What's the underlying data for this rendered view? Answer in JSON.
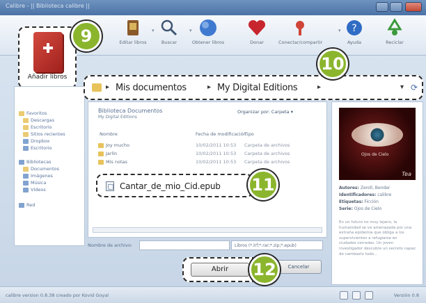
{
  "window": {
    "title": "Calibre - || Biblioteca calibre ||"
  },
  "toolbar": {
    "items": [
      {
        "label": "Añadir libros",
        "icon": "add-book-icon"
      },
      {
        "label": "Editar libros",
        "icon": "edit-metadata-icon"
      },
      {
        "label": "Buscar",
        "icon": "search-icon"
      },
      {
        "label": "Obtener libros",
        "icon": "globe-icon"
      },
      {
        "label": "Donar",
        "icon": "heart-icon"
      },
      {
        "label": "Conectar/compartir",
        "icon": "connect-share-icon"
      },
      {
        "label": "Ayuda",
        "icon": "help-icon"
      },
      {
        "label": "Reciclar",
        "icon": "recycle-icon"
      }
    ]
  },
  "add_book": {
    "label": "Añadir libros"
  },
  "steps": {
    "s9": "9",
    "s10": "10",
    "s11": "11",
    "s12": "12"
  },
  "address": {
    "crumbs": [
      "Mis documentos",
      "My Digital Editions"
    ],
    "separator": "▸"
  },
  "left_nav": {
    "items": [
      {
        "label": "Favoritos",
        "icon": "star"
      },
      {
        "label": "Descargas",
        "icon": "folder"
      },
      {
        "label": "Escritorio",
        "icon": "folder"
      },
      {
        "label": "Sitios recientes",
        "icon": "folder"
      },
      {
        "label": "Dropbox",
        "icon": "folder"
      },
      {
        "label": "Escritorio",
        "icon": "folder"
      },
      {
        "label": "Bibliotecas",
        "icon": "library"
      },
      {
        "label": "Documentos",
        "icon": "folder"
      },
      {
        "label": "Imágenes",
        "icon": "folder"
      },
      {
        "label": "Música",
        "icon": "folder"
      },
      {
        "label": "Vídeos",
        "icon": "folder"
      },
      {
        "label": "Red",
        "icon": "network"
      }
    ]
  },
  "file_area": {
    "title": "Biblioteca Documentos",
    "subtitle": "My Digital Editions",
    "organize": "Organizar por:",
    "organize_value": "Carpeta ▾",
    "columns": [
      "Nombre",
      "Fecha de modificación",
      "Tipo"
    ],
    "rows": [
      {
        "name": "Joy mucho",
        "date": "10/02/2011 10:53",
        "type": "Carpeta de archivos"
      },
      {
        "name": "Jarlín",
        "date": "10/02/2011 10:53",
        "type": "Carpeta de archivos"
      },
      {
        "name": "Mis notas",
        "date": "10/02/2011 10:53",
        "type": "Carpeta de archivos"
      }
    ]
  },
  "selected_file": {
    "name": "Cantar_de_mio_Cid.epub"
  },
  "filename_row": {
    "label": "Nombre de archivo:",
    "value": "",
    "filter": "Libros (*.lrf;*.rar;*.zip;*.epub)"
  },
  "buttons": {
    "open": "Abrir",
    "cancel": "Cancelar"
  },
  "book_info": {
    "cover_title": "Ojos de Cielo",
    "cover_logo": "Tea",
    "fields": [
      {
        "key": "Autores:",
        "value": "Zeroll, Bender"
      },
      {
        "key": "Identificadores:",
        "value": "calibre"
      },
      {
        "key": "Etiquetas:",
        "value": "Ficción"
      },
      {
        "key": "Serie:",
        "value": "Ojos de Cielo"
      }
    ],
    "description": "En un futuro no muy lejano, la humanidad se ve amenazada por una extraña epidemia que obliga a los supervivientes a refugiarse en ciudades cerradas. Un joven investigador descubre un secreto capaz de cambiarlo todo..."
  },
  "status": {
    "text": "calibre version 0.8.38 creado por Kovid Goyal",
    "version": "Versión 0.8"
  }
}
